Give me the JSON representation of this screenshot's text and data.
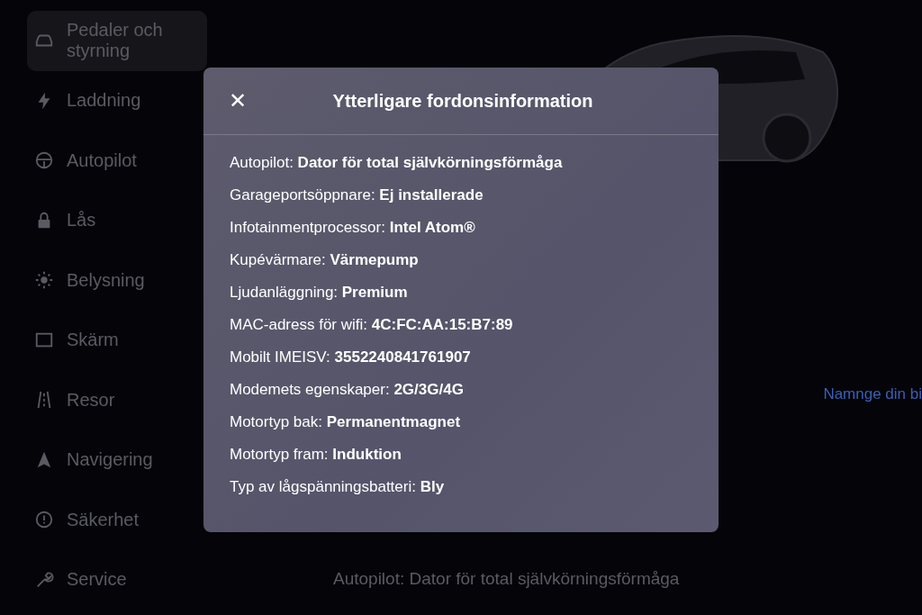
{
  "sidebar": {
    "items": [
      {
        "label": "Pedaler och styrning",
        "selected": true
      },
      {
        "label": "Laddning",
        "selected": false
      },
      {
        "label": "Autopilot",
        "selected": false
      },
      {
        "label": "Lås",
        "selected": false
      },
      {
        "label": "Belysning",
        "selected": false
      },
      {
        "label": "Skärm",
        "selected": false
      },
      {
        "label": "Resor",
        "selected": false
      },
      {
        "label": "Navigering",
        "selected": false
      },
      {
        "label": "Säkerhet",
        "selected": false
      },
      {
        "label": "Service",
        "selected": false
      }
    ]
  },
  "vehicle": {
    "rename_link": "Namnge din bi",
    "autopilot_line": "Autopilot: Dator för total självkörningsförmåga"
  },
  "dialog": {
    "close": "✕",
    "title": "Ytterligare fordonsinformation",
    "rows": [
      "Autopilot: **Dator för total självkörningsförmåga**",
      "Garageportsöppnare: **Ej installerade**",
      "Infotainmentprocessor: **Intel Atom®**",
      "Kupévärmare: **Värmepump**",
      "Ljudanläggning: **Premium**",
      "MAC-adress för wifi: **4C:FC:AA:15:B7:89**",
      "Mobilt IMEISV: **3552240841761907**",
      "Modemets egenskaper: **2G/3G/4G**",
      "Motortyp bak: **Permanentmagnet**",
      "Motortyp fram: **Induktion**",
      "Typ av lågspänningsbatteri: **Bly**"
    ]
  }
}
